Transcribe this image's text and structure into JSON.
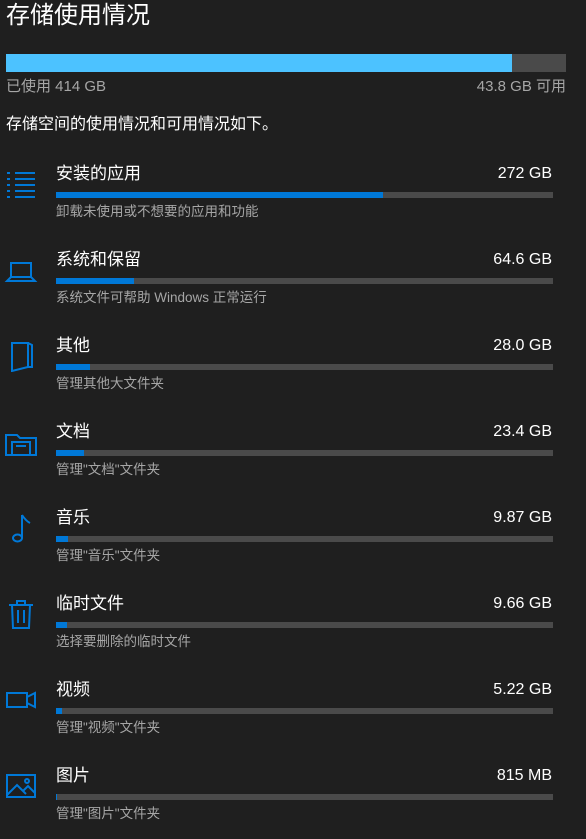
{
  "page": {
    "title": "存储使用情况",
    "used_text": "已使用 414 GB",
    "free_text": "43.8 GB 可用",
    "used_fraction": 0.904,
    "description": "存储空间的使用情况和可用情况如下。"
  },
  "colors": {
    "background": "#1f1f1f",
    "total_bar_fill": "#4cc2ff",
    "category_bar_fill": "#0078d7",
    "bar_track": "#4a4a4a",
    "secondary_text": "#a6a6a6",
    "icon": "#0078d7"
  },
  "categories": [
    {
      "icon": "app-list-icon",
      "name": "安装的应用",
      "size": "272 GB",
      "fraction": 0.657,
      "sub": "卸载未使用或不想要的应用和功能"
    },
    {
      "icon": "laptop-icon",
      "name": "系统和保留",
      "size": "64.6 GB",
      "fraction": 0.156,
      "sub": "系统文件可帮助 Windows 正常运行"
    },
    {
      "icon": "other-folder-icon",
      "name": "其他",
      "size": "28.0 GB",
      "fraction": 0.068,
      "sub": "管理其他大文件夹"
    },
    {
      "icon": "documents-icon",
      "name": "文档",
      "size": "23.4 GB",
      "fraction": 0.057,
      "sub": "管理\"文档\"文件夹"
    },
    {
      "icon": "music-note-icon",
      "name": "音乐",
      "size": "9.87 GB",
      "fraction": 0.024,
      "sub": "管理\"音乐\"文件夹"
    },
    {
      "icon": "trash-icon",
      "name": "临时文件",
      "size": "9.66 GB",
      "fraction": 0.023,
      "sub": "选择要删除的临时文件"
    },
    {
      "icon": "video-camera-icon",
      "name": "视频",
      "size": "5.22 GB",
      "fraction": 0.013,
      "sub": "管理\"视频\"文件夹"
    },
    {
      "icon": "picture-icon",
      "name": "图片",
      "size": "815 MB",
      "fraction": 0.002,
      "sub": "管理\"图片\"文件夹"
    }
  ]
}
